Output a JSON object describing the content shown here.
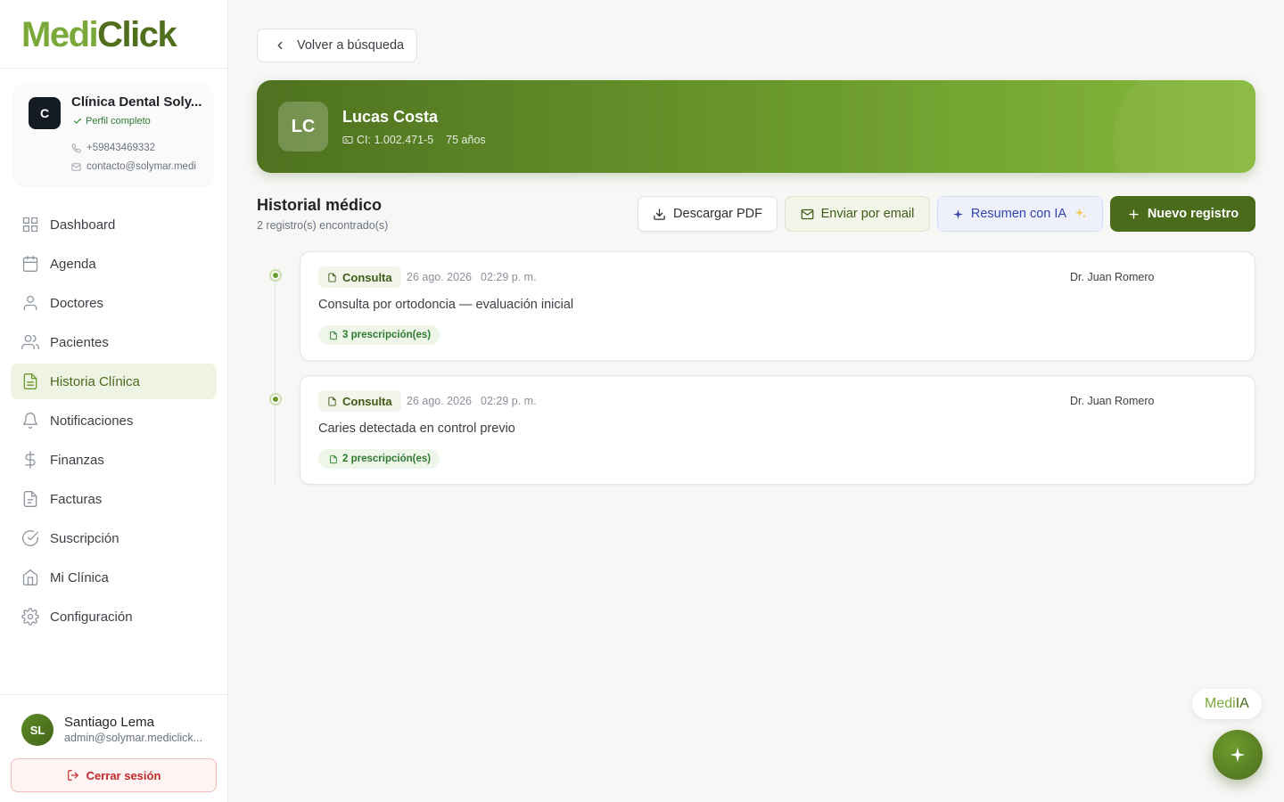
{
  "app": {
    "logo_part1": "Medi",
    "logo_part2": "Click"
  },
  "clinic": {
    "initial": "C",
    "name": "Clínica Dental Soly...",
    "badge": "Perfil completo",
    "phone": "+59843469332",
    "email": "contacto@solymar.medi"
  },
  "nav": [
    {
      "label": "Dashboard",
      "icon": "grid-icon"
    },
    {
      "label": "Agenda",
      "icon": "calendar-icon"
    },
    {
      "label": "Doctores",
      "icon": "user-icon"
    },
    {
      "label": "Pacientes",
      "icon": "users-icon"
    },
    {
      "label": "Historia Clínica",
      "icon": "file-text-icon",
      "active": true
    },
    {
      "label": "Notificaciones",
      "icon": "bell-icon"
    },
    {
      "label": "Finanzas",
      "icon": "dollar-icon"
    },
    {
      "label": "Facturas",
      "icon": "invoice-icon"
    },
    {
      "label": "Suscripción",
      "icon": "check-circle-icon"
    },
    {
      "label": "Mi Clínica",
      "icon": "home-icon"
    },
    {
      "label": "Configuración",
      "icon": "gear-icon"
    }
  ],
  "user": {
    "initials": "SL",
    "name": "Santiago Lema",
    "email": "admin@solymar.mediclick...",
    "logout_label": "Cerrar sesión"
  },
  "back_label": "Volver a búsqueda",
  "patient": {
    "initials": "LC",
    "name": "Lucas Costa",
    "ci": "CI: 1.002.471-5",
    "age": "75 años"
  },
  "history": {
    "title": "Historial médico",
    "count": "2 registro(s) encontrado(s)",
    "buttons": {
      "pdf": "Descargar PDF",
      "email": "Enviar por email",
      "ia": "Resumen con IA",
      "new": "Nuevo registro"
    },
    "records": [
      {
        "type": "Consulta",
        "date": "26 ago. 2026",
        "time": "02:29 p. m.",
        "doctor": "Dr. Juan Romero",
        "description": "Consulta por ortodoncia — evaluación inicial",
        "prescriptions": "3 prescripción(es)"
      },
      {
        "type": "Consulta",
        "date": "26 ago. 2026",
        "time": "02:29 p. m.",
        "doctor": "Dr. Juan Romero",
        "description": "Caries detectada en control previo",
        "prescriptions": "2 prescripción(es)"
      }
    ]
  },
  "assistant": {
    "label_part1": "Medi",
    "label_part2": "IA"
  },
  "colors": {
    "brand_dark": "#4a6a1c",
    "brand_light": "#7aa93a",
    "danger": "#c62828"
  }
}
